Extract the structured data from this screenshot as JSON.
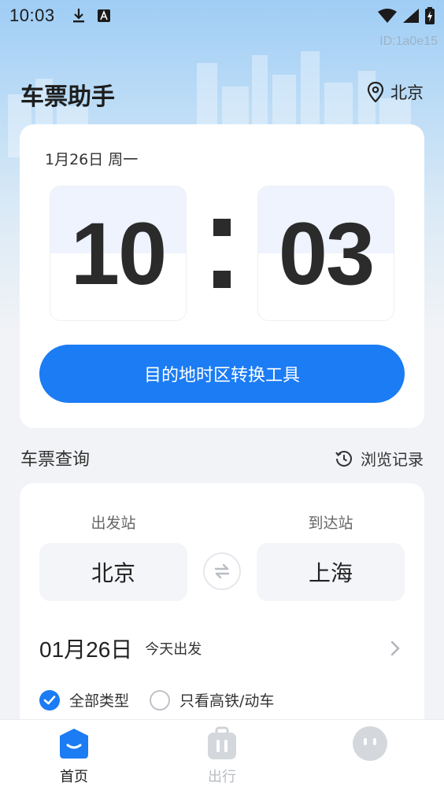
{
  "status_bar": {
    "time": "10:03",
    "icons_left": [
      "download-icon",
      "text-input-icon"
    ],
    "icons_right": [
      "wifi-icon",
      "signal-icon",
      "battery-icon"
    ]
  },
  "watermark": "ID:1a0e15",
  "header": {
    "app_title": "车票助手",
    "location": "北京",
    "location_icon": "location-pin-icon"
  },
  "clock_card": {
    "date_label": "1月26日 周一",
    "hours": "10",
    "minutes": "03",
    "convert_button": "目的地时区转换工具"
  },
  "ticket_section": {
    "title": "车票查询",
    "history_label": "浏览记录",
    "departure_label": "出发站",
    "arrival_label": "到达站",
    "departure_station": "北京",
    "arrival_station": "上海",
    "date": "01月26日",
    "date_hint": "今天出发",
    "options": [
      {
        "label": "全部类型",
        "checked": true
      },
      {
        "label": "只看高铁/动车",
        "checked": false
      }
    ]
  },
  "tabbar": {
    "tabs": [
      {
        "label": "首页",
        "icon": "home-icon",
        "active": true
      },
      {
        "label": "出行",
        "icon": "luggage-icon",
        "active": false
      },
      {
        "label": "",
        "icon": "smiley-icon",
        "active": false
      }
    ]
  },
  "colors": {
    "accent": "#1b7cf4",
    "background": "#f1f3f6",
    "card": "#ffffff"
  }
}
